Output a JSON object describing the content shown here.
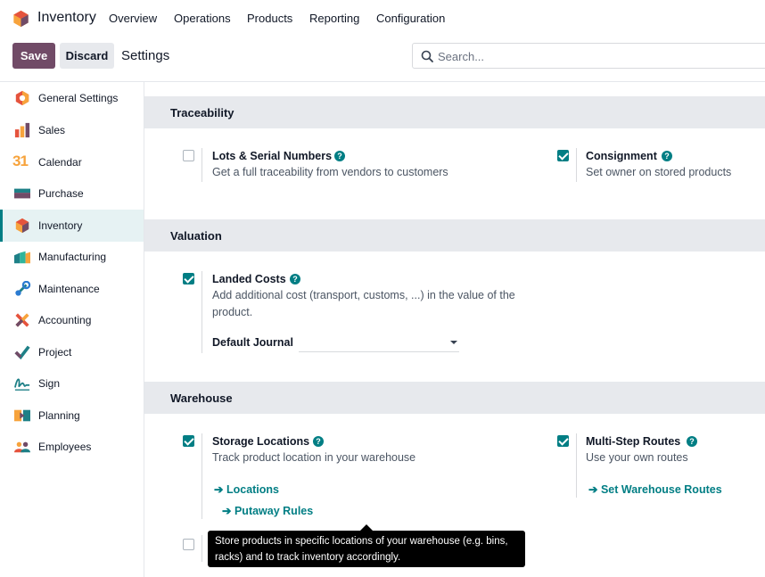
{
  "navbar": {
    "app_name": "Inventory",
    "menus": [
      "Overview",
      "Operations",
      "Products",
      "Reporting",
      "Configuration"
    ]
  },
  "control_panel": {
    "save_label": "Save",
    "discard_label": "Discard",
    "breadcrumb": "Settings",
    "search_placeholder": "Search...",
    "search_icon": "search-icon"
  },
  "sidebar": {
    "items": [
      {
        "label": "General Settings",
        "icon": "general-settings-icon"
      },
      {
        "label": "Sales",
        "icon": "sales-icon"
      },
      {
        "label": "Calendar",
        "icon": "calendar-icon"
      },
      {
        "label": "Purchase",
        "icon": "purchase-icon"
      },
      {
        "label": "Inventory",
        "icon": "inventory-icon",
        "active": true
      },
      {
        "label": "Manufacturing",
        "icon": "manufacturing-icon"
      },
      {
        "label": "Maintenance",
        "icon": "maintenance-icon"
      },
      {
        "label": "Accounting",
        "icon": "accounting-icon"
      },
      {
        "label": "Project",
        "icon": "project-icon"
      },
      {
        "label": "Sign",
        "icon": "sign-icon"
      },
      {
        "label": "Planning",
        "icon": "planning-icon"
      },
      {
        "label": "Employees",
        "icon": "employees-icon"
      }
    ],
    "calendar_glyph": "31"
  },
  "sections": {
    "traceability": {
      "title": "Traceability",
      "lots": {
        "title": "Lots & Serial Numbers",
        "desc": "Get a full traceability from vendors to customers",
        "checked": false
      },
      "consignment": {
        "title": "Consignment",
        "desc": "Set owner on stored products",
        "checked": true
      }
    },
    "valuation": {
      "title": "Valuation",
      "landed": {
        "title": "Landed Costs",
        "desc": "Add additional cost (transport, customs, ...) in the value of the product.",
        "checked": true
      },
      "journal_label": "Default Journal",
      "journal_value": ""
    },
    "warehouse": {
      "title": "Warehouse",
      "storage": {
        "title": "Storage Locations",
        "desc": "Track product location in your warehouse",
        "checked": true,
        "link1": "Locations",
        "link2": "Putaway Rules"
      },
      "routes": {
        "title": "Multi-Step Routes",
        "desc": "Use your own routes",
        "checked": true,
        "link": "Set Warehouse Routes"
      }
    }
  },
  "help_glyph": "?",
  "arrow_glyph": "➔",
  "tooltip": {
    "text": "Store products in specific locations of your warehouse (e.g. bins, racks) and to track inventory accordingly."
  },
  "colors": {
    "brand": "#714b67",
    "accent": "#017e84",
    "section_bg": "#e7e9ed",
    "active_bg": "#e6f2f3"
  }
}
